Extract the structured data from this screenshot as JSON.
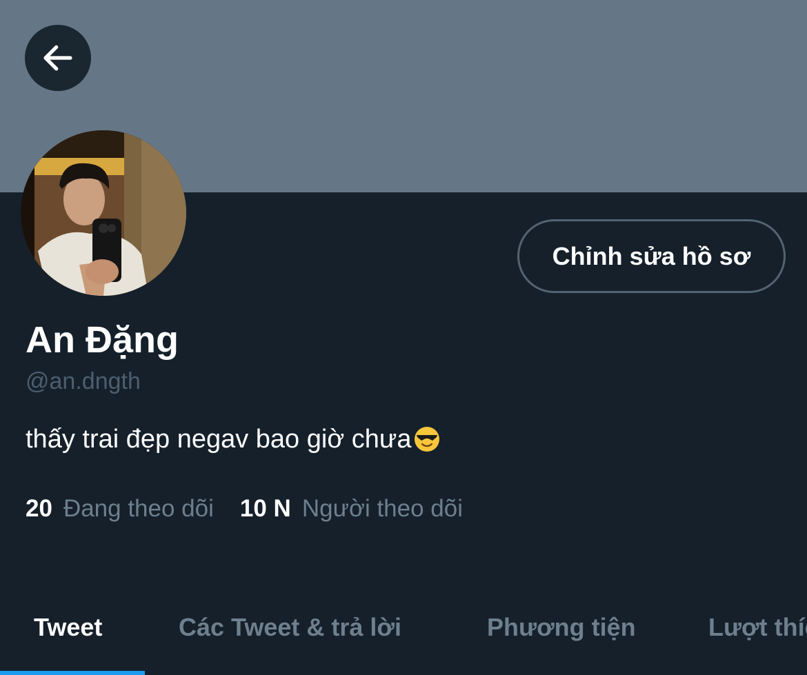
{
  "profile": {
    "display_name": "An Đặng",
    "handle": "@an.dngth",
    "bio": "thấy trai đẹp negav bao giờ chưa"
  },
  "actions": {
    "edit_profile_label": "Chỉnh sửa hồ sơ"
  },
  "stats": {
    "following_count": "20",
    "following_label": "Đang theo dõi",
    "followers_count": "10 N",
    "followers_label": "Người theo dõi"
  },
  "tabs": [
    {
      "label": "Tweet",
      "active": true
    },
    {
      "label": "Các Tweet & trả lời",
      "active": false
    },
    {
      "label": "Phương tiện",
      "active": false
    },
    {
      "label": "Lượt thích",
      "active": false
    }
  ],
  "icons": {
    "back": "arrow-left-icon",
    "bio_emoji": "sunglasses-emoji-icon"
  },
  "colors": {
    "background": "#15202b",
    "banner": "#657786",
    "accent": "#1d9bf0",
    "secondary_text": "#6e7f8d"
  }
}
